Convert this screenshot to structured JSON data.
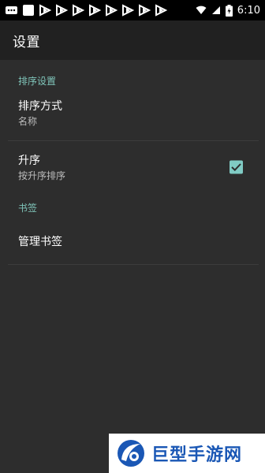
{
  "status_bar": {
    "time": "6:10",
    "battery_icon": "battery-charging-icon",
    "notification_icons": [
      "message-icon",
      "notification-square-icon",
      "play-icon",
      "play-icon",
      "play-icon",
      "play-icon",
      "play-icon",
      "play-icon",
      "play-icon",
      "play-icon"
    ]
  },
  "app_bar": {
    "title": "设置"
  },
  "sections": {
    "sort": {
      "header": "排序设置",
      "sort_mode": {
        "title": "排序方式",
        "summary": "名称"
      },
      "ascending": {
        "title": "升序",
        "summary": "按升序排序",
        "checked": true
      }
    },
    "bookmarks": {
      "header": "书签",
      "manage": {
        "title": "管理书签"
      }
    }
  },
  "watermark": {
    "text": "巨型手游网"
  },
  "colors": {
    "accent": "#80cbc4",
    "background": "#2d2d2d",
    "toolbar": "#212121",
    "category_text": "#7fc4b9"
  }
}
